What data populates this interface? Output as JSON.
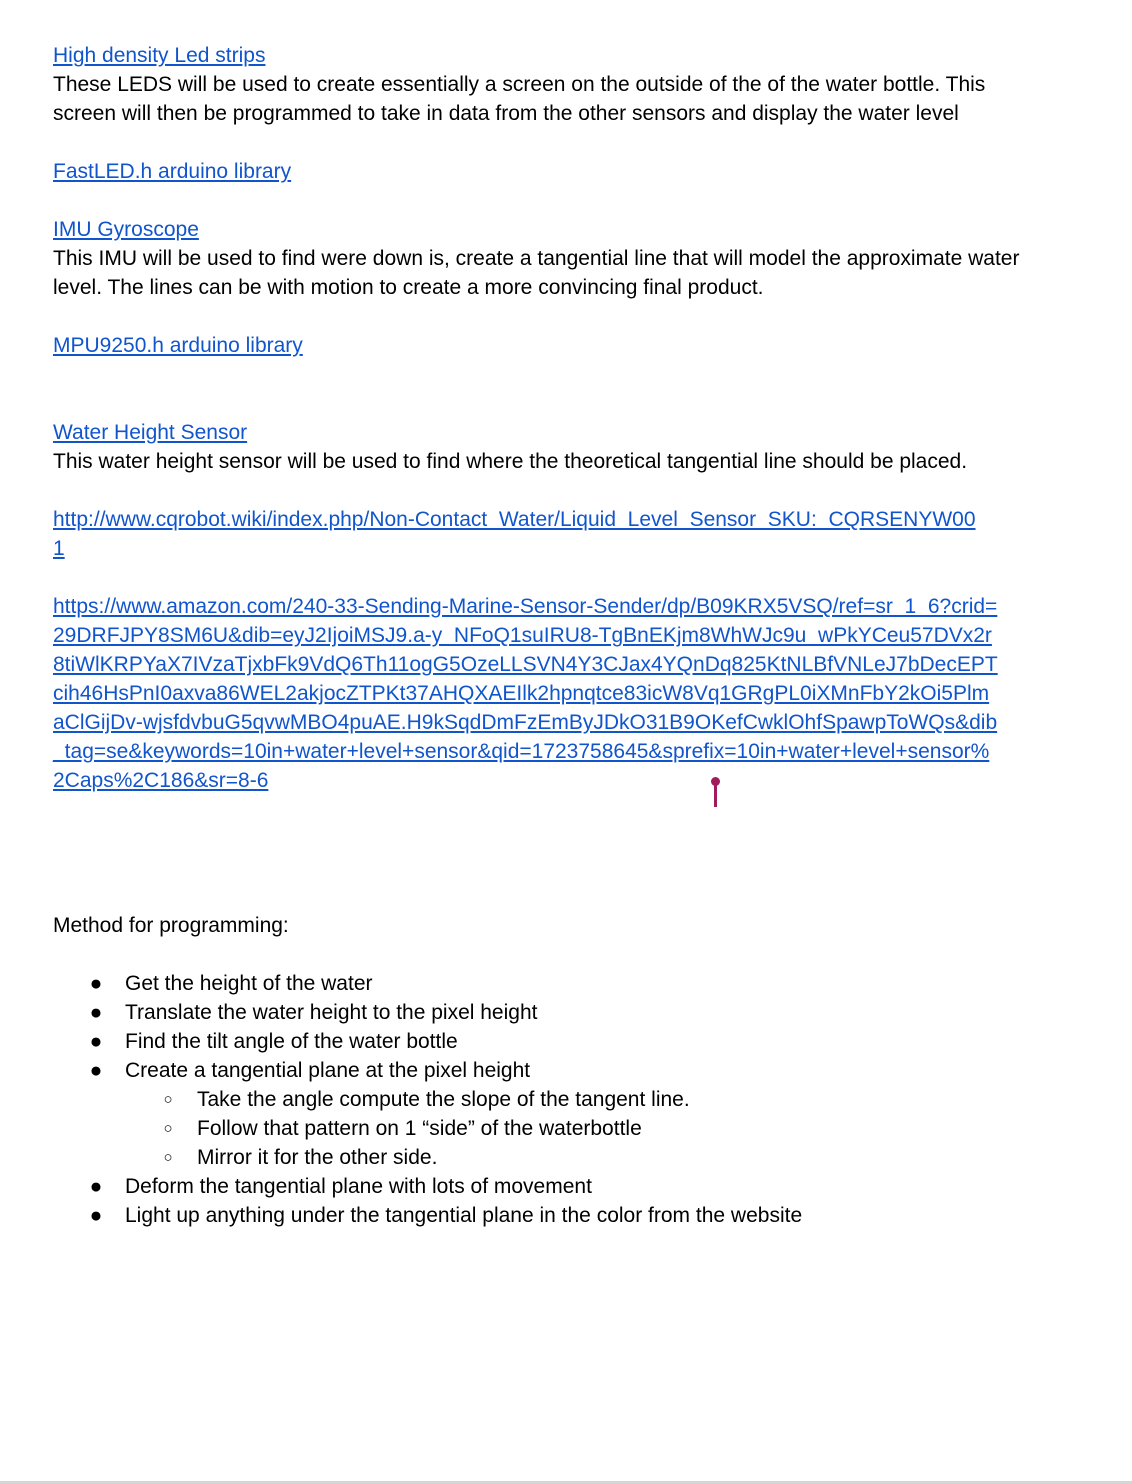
{
  "sections": {
    "led": {
      "link": "High density Led strips",
      "text": "These LEDS will be used to create essentially a screen on the outside of the of the water bottle. This screen will then be programmed to take in data from the other sensors and display the water level"
    },
    "fastled": {
      "link": "FastLED.h arduino library"
    },
    "imu": {
      "link": "IMU Gyroscope",
      "text": "This IMU will be used to find were down is, create a tangential line that will model the approximate water level. The lines can be with motion to create a more convincing final product."
    },
    "mpu": {
      "link": "MPU9250.h arduino library"
    },
    "water": {
      "link": "Water Height Sensor",
      "text": "This water height sensor will be used to find where the theoretical tangential line should be placed.",
      "url1": "http://www.cqrobot.wiki/index.php/Non-Contact_Water/Liquid_Level_Sensor_SKU:_CQRSENYW001",
      "url2": "https://www.amazon.com/240-33-Sending-Marine-Sensor-Sender/dp/B09KRX5VSQ/ref=sr_1_6?crid=29DRFJPY8SM6U&dib=eyJ2IjoiMSJ9.a-y_NFoQ1suIRU8-TgBnEKjm8WhWJc9u_wPkYCeu57DVx2r8tiWlKRPYaX7IVzaTjxbFk9VdQ6Th11ogG5OzeLLSVN4Y3CJax4YQnDq825KtNLBfVNLeJ7bDecEPTcih46HsPnI0axva86WEL2akjocZTPKt37AHQXAEIlk2hpnqtce83icW8Vq1GRgPL0iXMnFbY2kOi5PlmaClGijDv-wjsfdvbuG5qvwMBO4puAE.H9kSqdDmFzEmByJDkO31B9OKefCwklOhfSpawpToWQs&dib_tag=se&keywords=10in+water+level+sensor&qid=1723758645&sprefix=10in+water+level+sensor%2Caps%2C186&sr=8-6"
    }
  },
  "method": {
    "heading": "Method for programming:",
    "bullet_glyph": "●",
    "sub_glyph": "○",
    "items": [
      "Get the height of the water",
      "Translate the water height to the pixel height",
      "Find the tilt angle of the water bottle",
      "Create a tangential plane at the pixel height"
    ],
    "sub_items": [
      "Take the angle compute the slope of the tangent line.",
      "Follow that pattern on 1 “side” of the waterbottle",
      "Mirror it for the other side."
    ],
    "items_after": [
      "Deform the tangential plane with lots of movement",
      "Light up anything under the tangential plane in the color from the website"
    ]
  },
  "colors": {
    "link": "#1155cc",
    "text": "#000000",
    "cursor": "#a31a5c"
  }
}
